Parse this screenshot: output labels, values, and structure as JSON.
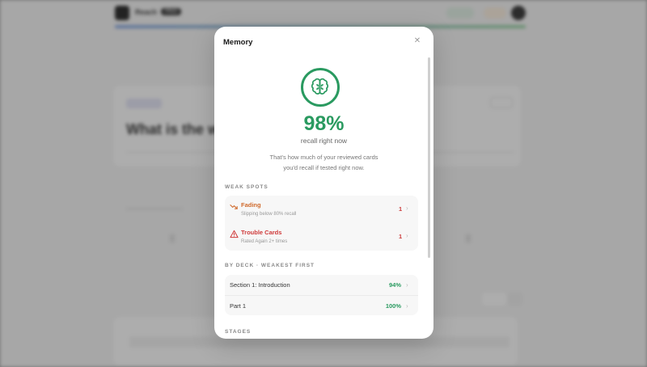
{
  "background": {
    "app_name": "Reach",
    "badge": "PRO",
    "question_partial": "What is the w"
  },
  "modal": {
    "title": "Memory",
    "close_icon": "close-icon",
    "recall_value": "98%",
    "recall_label": "recall right now",
    "description_line1": "That's how much of your reviewed cards",
    "description_line2": "you'd recall if tested right now.",
    "weak_spots": {
      "label": "WEAK SPOTS",
      "items": [
        {
          "title": "Fading",
          "subtitle": "Slipping below 80% recall",
          "count": "1",
          "icon": "trending-down-icon",
          "color": "#d06a2c"
        },
        {
          "title": "Trouble Cards",
          "subtitle": "Rated Again 2+ times",
          "count": "1",
          "icon": "warning-triangle-icon",
          "color": "#cf3a3a"
        }
      ]
    },
    "by_deck": {
      "label": "BY DECK · WEAKEST FIRST",
      "items": [
        {
          "name": "Section 1: Introduction",
          "percent": "94%"
        },
        {
          "name": "Part 1",
          "percent": "100%"
        }
      ]
    },
    "stages_label": "STAGES",
    "accent_color": "#2a9a60"
  }
}
